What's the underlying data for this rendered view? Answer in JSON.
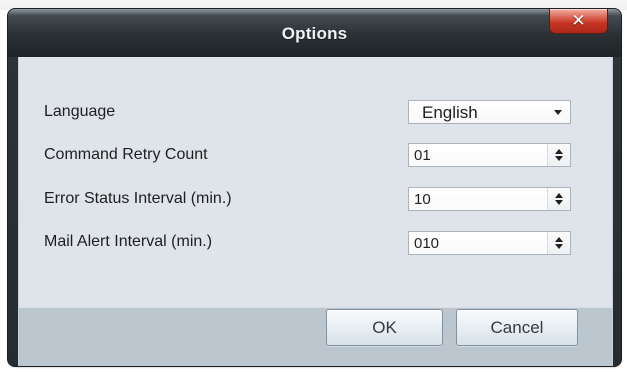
{
  "window": {
    "title": "Options",
    "close_icon": "close-icon",
    "close_glyph": "✕"
  },
  "form": {
    "language_label": "Language",
    "command_retry_count_label": "Command Retry Count",
    "error_status_interval_label": "Error Status Interval (min.)",
    "mail_alert_interval_label": "Mail Alert Interval (min.)",
    "language_value": "English",
    "command_retry_count_value": "01",
    "error_status_interval_value": "10",
    "mail_alert_interval_value": "010"
  },
  "footer": {
    "ok_label": "OK",
    "cancel_label": "Cancel"
  },
  "icons": {
    "language_dropdown": "chevron-down-icon",
    "spinner_up": "spinner-up-icon",
    "spinner_down": "spinner-down-icon"
  },
  "colors": {
    "titlebar": "#2a3034",
    "content_background": "#dee4e9",
    "footer_background": "#bcc6cf",
    "close_button": "#c73522",
    "button_border": "#8292a0"
  }
}
